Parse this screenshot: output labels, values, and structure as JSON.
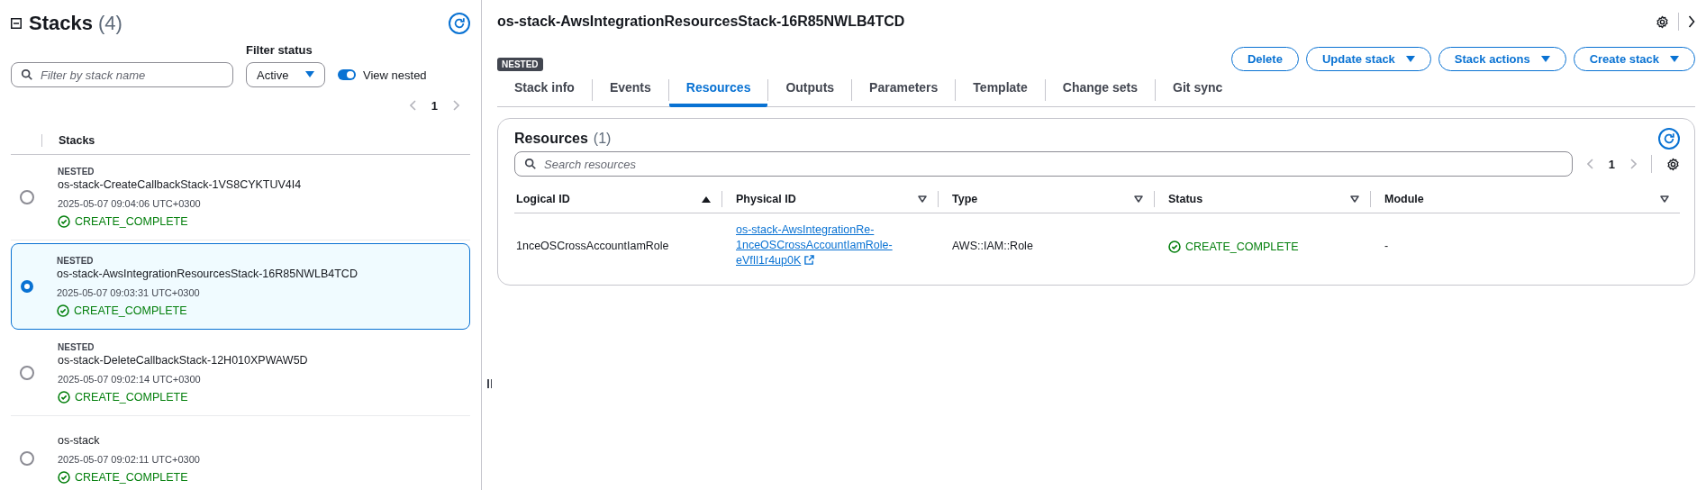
{
  "stacks_panel": {
    "title": "Stacks",
    "count": "(4)",
    "filter": {
      "placeholder": "Filter by stack name"
    },
    "filter_status": {
      "label": "Filter status",
      "value": "Active"
    },
    "view_nested": {
      "label": "View nested",
      "on": true
    },
    "pagination": {
      "page": "1"
    },
    "column": "Stacks",
    "stacks": [
      {
        "badge": "NESTED",
        "name": "os-stack-CreateCallbackStack-1VS8CYKTUV4I4",
        "time": "2025-05-07 09:04:06 UTC+0300",
        "status": "CREATE_COMPLETE",
        "selected": false
      },
      {
        "badge": "NESTED",
        "name": "os-stack-AwsIntegrationResourcesStack-16R85NWLB4TCD",
        "time": "2025-05-07 09:03:31 UTC+0300",
        "status": "CREATE_COMPLETE",
        "selected": true
      },
      {
        "badge": "NESTED",
        "name": "os-stack-DeleteCallbackStack-12H010XPWAW5D",
        "time": "2025-05-07 09:02:14 UTC+0300",
        "status": "CREATE_COMPLETE",
        "selected": false
      },
      {
        "name": "os-stack",
        "time": "2025-05-07 09:02:11 UTC+0300",
        "status": "CREATE_COMPLETE",
        "selected": false
      }
    ]
  },
  "detail": {
    "title": "os-stack-AwsIntegrationResourcesStack-16R85NWLB4TCD",
    "badge": "NESTED",
    "buttons": [
      {
        "label": "Delete",
        "dropdown": false
      },
      {
        "label": "Update stack",
        "dropdown": true
      },
      {
        "label": "Stack actions",
        "dropdown": true
      },
      {
        "label": "Create stack",
        "dropdown": true
      }
    ],
    "tabs": [
      {
        "label": "Stack info",
        "selected": false
      },
      {
        "label": "Events",
        "selected": false
      },
      {
        "label": "Resources",
        "selected": true
      },
      {
        "label": "Outputs",
        "selected": false
      },
      {
        "label": "Parameters",
        "selected": false
      },
      {
        "label": "Template",
        "selected": false
      },
      {
        "label": "Change sets",
        "selected": false
      },
      {
        "label": "Git sync",
        "selected": false
      }
    ],
    "resources": {
      "title": "Resources",
      "count": "(1)",
      "search": {
        "placeholder": "Search resources"
      },
      "pagination": {
        "page": "1"
      },
      "columns": [
        {
          "label": "Logical ID",
          "sorted": true
        },
        {
          "label": "Physical ID",
          "sorted": false
        },
        {
          "label": "Type",
          "sorted": false
        },
        {
          "label": "Status",
          "sorted": false
        },
        {
          "label": "Module",
          "sorted": false
        }
      ],
      "rows": [
        {
          "logical_id": "1nceOSCrossAccountIamRole",
          "physical_id": [
            "os-stack-AwsIntegrationRe-",
            "1nceOSCrossAccountIamRole-",
            "eVfIl1r4up0K"
          ],
          "type": "AWS::IAM::Role",
          "status": "CREATE_COMPLETE",
          "module": "-"
        }
      ]
    }
  }
}
